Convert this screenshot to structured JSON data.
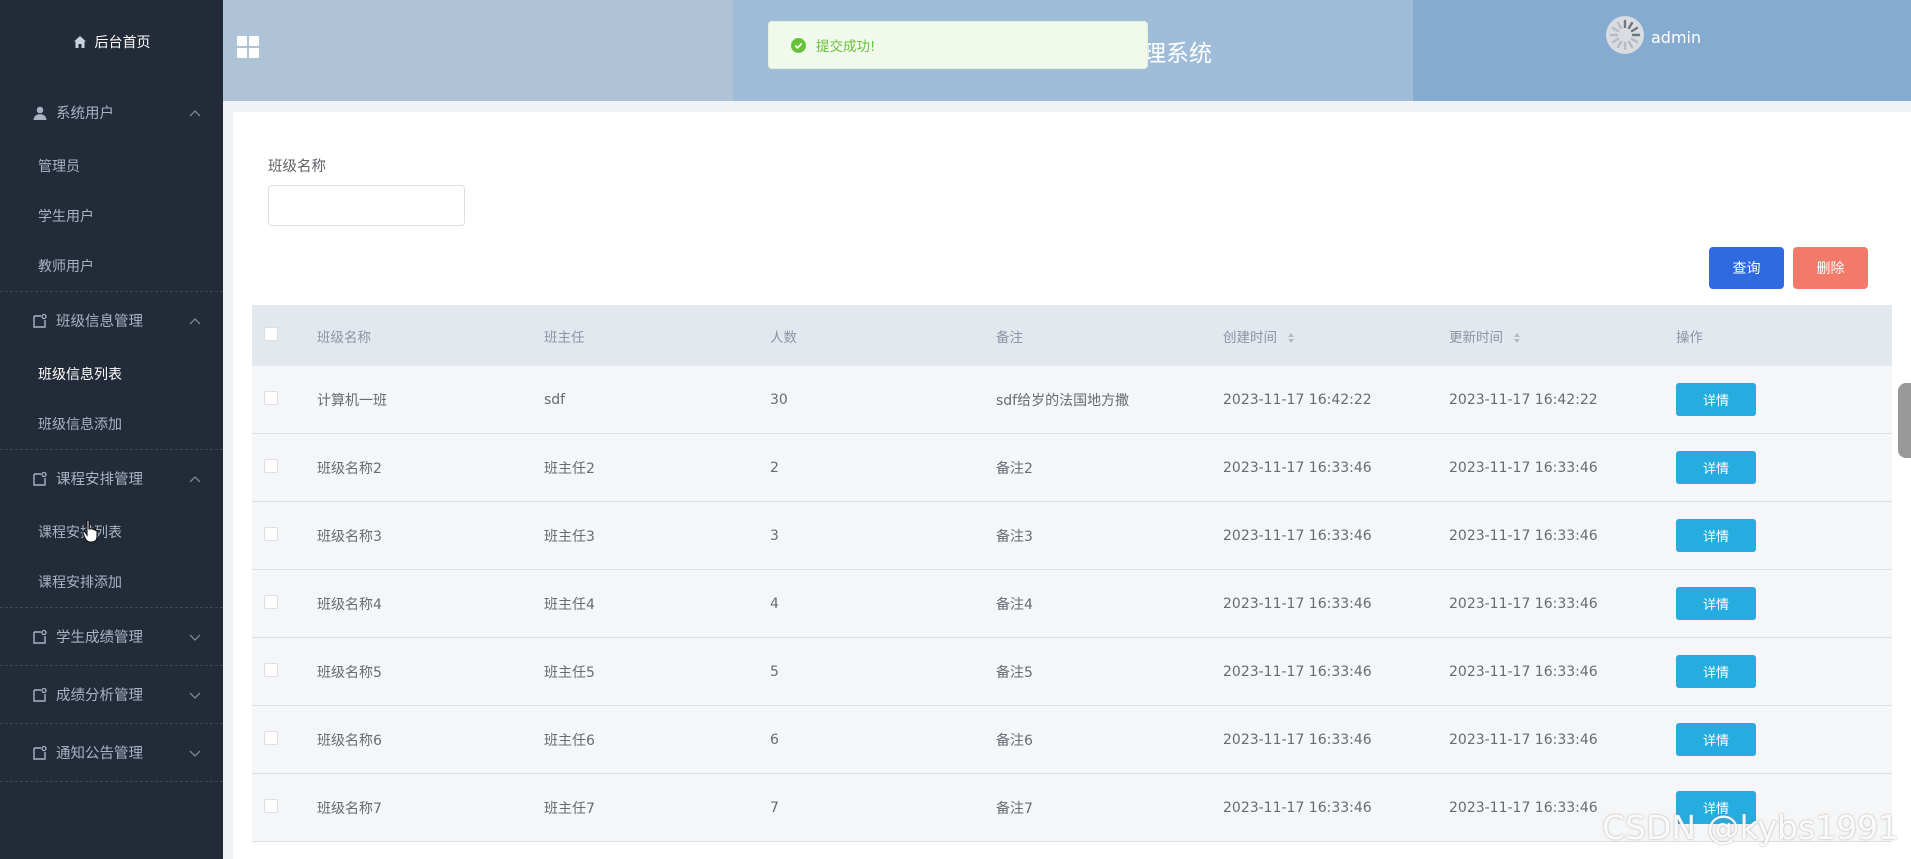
{
  "sidebar": {
    "home_label": "后台首页",
    "groups": [
      {
        "title": "系统用户",
        "items": [
          "管理员",
          "学生用户",
          "教师用户"
        ]
      },
      {
        "title": "班级信息管理",
        "items": [
          "班级信息列表",
          "班级信息添加"
        ]
      },
      {
        "title": "课程安排管理",
        "items": [
          "课程安排列表",
          "课程安排添加"
        ]
      },
      {
        "title": "学生成绩管理"
      },
      {
        "title": "成绩分析管理"
      },
      {
        "title": "通知公告管理"
      }
    ]
  },
  "header": {
    "system_title": "理系统",
    "username": "admin",
    "toast": "提交成功!"
  },
  "filter": {
    "label": "班级名称",
    "value": "",
    "query_button": "查询",
    "delete_button": "删除"
  },
  "table": {
    "columns": [
      "班级名称",
      "班主任",
      "人数",
      "备注",
      "创建时间",
      "更新时间",
      "操作"
    ],
    "detail_label": "详情",
    "rows": [
      {
        "name": "计算机一班",
        "teacher": "sdf",
        "count": "30",
        "note": "sdf给岁的法国地方撒",
        "created": "2023-11-17 16:42:22",
        "updated": "2023-11-17 16:42:22"
      },
      {
        "name": "班级名称2",
        "teacher": "班主任2",
        "count": "2",
        "note": "备注2",
        "created": "2023-11-17 16:33:46",
        "updated": "2023-11-17 16:33:46"
      },
      {
        "name": "班级名称3",
        "teacher": "班主任3",
        "count": "3",
        "note": "备注3",
        "created": "2023-11-17 16:33:46",
        "updated": "2023-11-17 16:33:46"
      },
      {
        "name": "班级名称4",
        "teacher": "班主任4",
        "count": "4",
        "note": "备注4",
        "created": "2023-11-17 16:33:46",
        "updated": "2023-11-17 16:33:46"
      },
      {
        "name": "班级名称5",
        "teacher": "班主任5",
        "count": "5",
        "note": "备注5",
        "created": "2023-11-17 16:33:46",
        "updated": "2023-11-17 16:33:46"
      },
      {
        "name": "班级名称6",
        "teacher": "班主任6",
        "count": "6",
        "note": "备注6",
        "created": "2023-11-17 16:33:46",
        "updated": "2023-11-17 16:33:46"
      },
      {
        "name": "班级名称7",
        "teacher": "班主任7",
        "count": "7",
        "note": "备注7",
        "created": "2023-11-17 16:33:46",
        "updated": "2023-11-17 16:33:46"
      }
    ]
  },
  "watermark": "CSDN @kybs1991",
  "colors": {
    "sidebar_bg": "#232a38",
    "query_button": "#2f6ae0",
    "delete_button": "#f27a6a",
    "detail_button": "#27ace0",
    "toast_text": "#67c23a"
  }
}
